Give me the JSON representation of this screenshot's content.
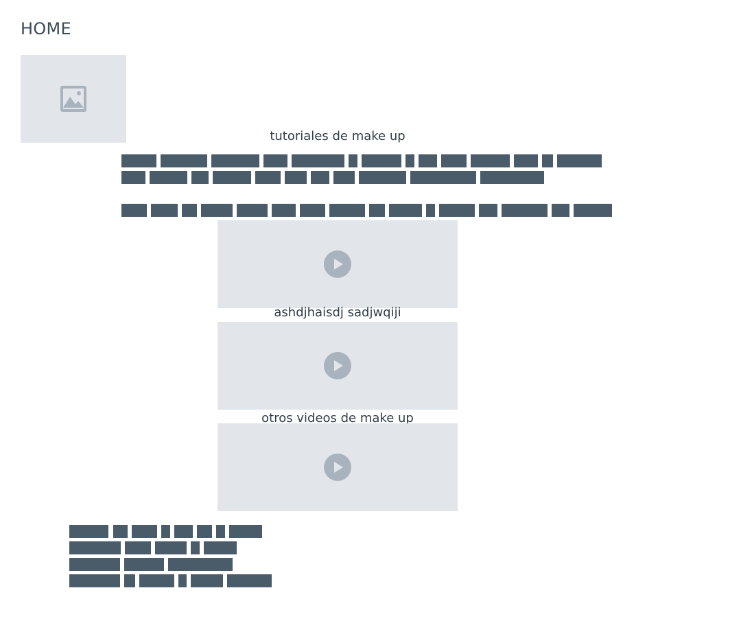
{
  "page": {
    "title": "HOME"
  },
  "image_placeholder": {
    "icon": "image-icon"
  },
  "sections": [
    {
      "caption": "tutoriales de make up"
    },
    {
      "caption": "ashdjhaisdj sadjwqiji"
    },
    {
      "caption": "otros videos de make up"
    }
  ],
  "videos": [
    {
      "icon": "play-icon"
    },
    {
      "icon": "play-icon"
    },
    {
      "icon": "play-icon"
    }
  ],
  "colors": {
    "placeholder_bg": "#e2e6ea",
    "placeholder_icon": "#a8b3bd",
    "redacted_text": "#4a5b6a"
  }
}
